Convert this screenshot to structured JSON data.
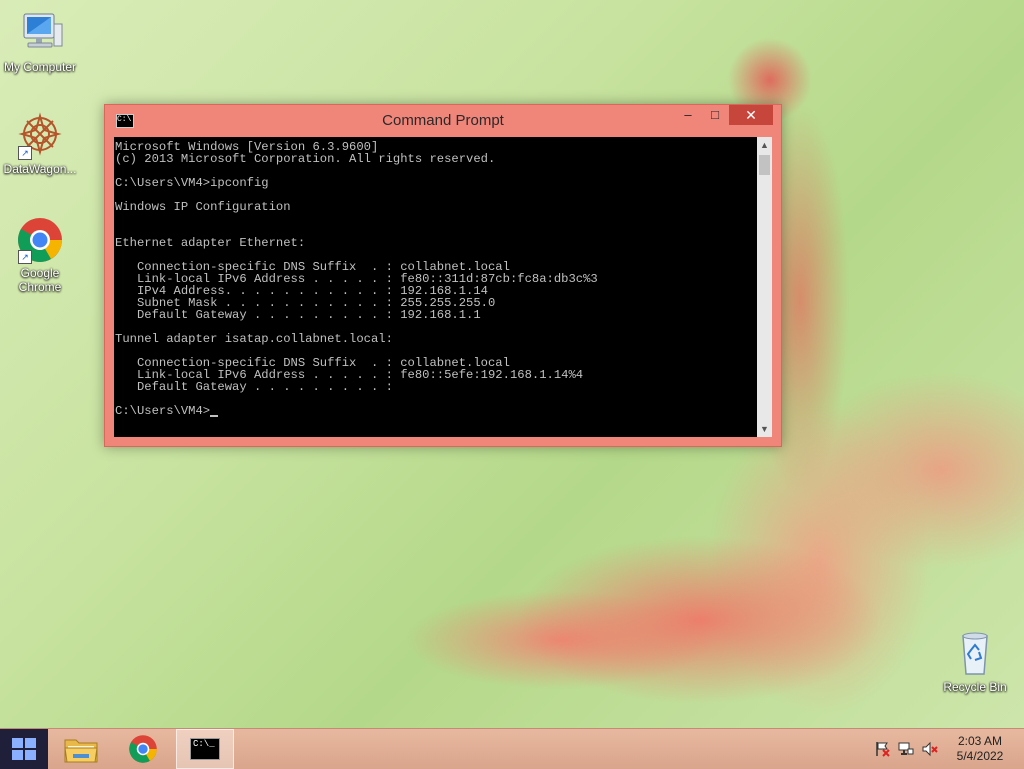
{
  "desktop": {
    "icons": [
      {
        "label": "My Computer",
        "icon": "computer-icon"
      },
      {
        "label": "DataWagon...",
        "icon": "datawagon-icon"
      },
      {
        "label": "Google\nChrome",
        "label_line1": "Google",
        "label_line2": "Chrome",
        "icon": "chrome-icon"
      },
      {
        "label": "Recycle Bin",
        "icon": "recycle-bin-icon"
      }
    ]
  },
  "window": {
    "title": "Command Prompt",
    "icon": "cmd-icon",
    "buttons": {
      "minimize": "–",
      "maximize": "□",
      "close": "✕"
    },
    "console_text": "Microsoft Windows [Version 6.3.9600]\n(c) 2013 Microsoft Corporation. All rights reserved.\n\nC:\\Users\\VM4>ipconfig\n\nWindows IP Configuration\n\n\nEthernet adapter Ethernet:\n\n   Connection-specific DNS Suffix  . : collabnet.local\n   Link-local IPv6 Address . . . . . : fe80::311d:87cb:fc8a:db3c%3\n   IPv4 Address. . . . . . . . . . . : 192.168.1.14\n   Subnet Mask . . . . . . . . . . . : 255.255.255.0\n   Default Gateway . . . . . . . . . : 192.168.1.1\n\nTunnel adapter isatap.collabnet.local:\n\n   Connection-specific DNS Suffix  . : collabnet.local\n   Link-local IPv6 Address . . . . . : fe80::5efe:192.168.1.14%4\n   Default Gateway . . . . . . . . . :\n\nC:\\Users\\VM4>",
    "console_colors": {
      "background": "#000000",
      "text": "#c0c0c0"
    },
    "frame_color": "#f0857a"
  },
  "taskbar": {
    "items": [
      {
        "name": "file-explorer",
        "icon": "folder-icon"
      },
      {
        "name": "google-chrome",
        "icon": "chrome-icon"
      },
      {
        "name": "command-prompt",
        "icon": "cmd-icon",
        "active": true
      }
    ],
    "tray": [
      "flag-icon",
      "network-icon",
      "volume-muted-icon"
    ],
    "clock": {
      "time": "2:03 AM",
      "date": "5/4/2022"
    }
  }
}
